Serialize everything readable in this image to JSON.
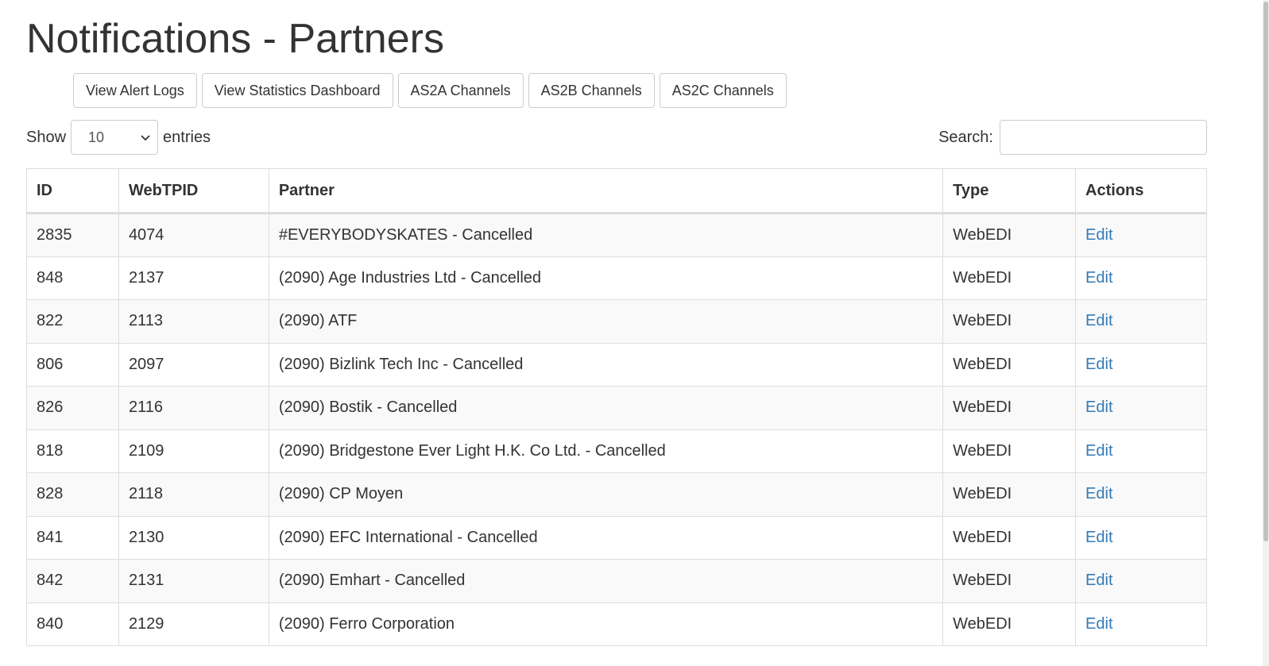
{
  "page": {
    "title": "Notifications - Partners"
  },
  "toolbar": {
    "buttons": [
      {
        "label": "View Alert Logs"
      },
      {
        "label": "View Statistics Dashboard"
      },
      {
        "label": "AS2A Channels"
      },
      {
        "label": "AS2B Channels"
      },
      {
        "label": "AS2C Channels"
      }
    ]
  },
  "length_control": {
    "show_label": "Show",
    "selected": "10",
    "entries_label": "entries"
  },
  "search": {
    "label": "Search:",
    "value": ""
  },
  "table": {
    "columns": [
      "ID",
      "WebTPID",
      "Partner",
      "Type",
      "Actions"
    ],
    "rows": [
      {
        "id": "2835",
        "webtpid": "4074",
        "partner": "#EVERYBODYSKATES - Cancelled",
        "type": "WebEDI",
        "action": "Edit"
      },
      {
        "id": "848",
        "webtpid": "2137",
        "partner": "(2090) Age Industries Ltd - Cancelled",
        "type": "WebEDI",
        "action": "Edit"
      },
      {
        "id": "822",
        "webtpid": "2113",
        "partner": "(2090) ATF",
        "type": "WebEDI",
        "action": "Edit"
      },
      {
        "id": "806",
        "webtpid": "2097",
        "partner": "(2090) Bizlink Tech Inc - Cancelled",
        "type": "WebEDI",
        "action": "Edit"
      },
      {
        "id": "826",
        "webtpid": "2116",
        "partner": "(2090) Bostik - Cancelled",
        "type": "WebEDI",
        "action": "Edit"
      },
      {
        "id": "818",
        "webtpid": "2109",
        "partner": "(2090) Bridgestone Ever Light H.K. Co Ltd. - Cancelled",
        "type": "WebEDI",
        "action": "Edit"
      },
      {
        "id": "828",
        "webtpid": "2118",
        "partner": "(2090) CP Moyen",
        "type": "WebEDI",
        "action": "Edit"
      },
      {
        "id": "841",
        "webtpid": "2130",
        "partner": "(2090) EFC International - Cancelled",
        "type": "WebEDI",
        "action": "Edit"
      },
      {
        "id": "842",
        "webtpid": "2131",
        "partner": "(2090) Emhart - Cancelled",
        "type": "WebEDI",
        "action": "Edit"
      },
      {
        "id": "840",
        "webtpid": "2129",
        "partner": "(2090) Ferro Corporation",
        "type": "WebEDI",
        "action": "Edit"
      }
    ]
  },
  "icons": {
    "select_arrow": "chevron-down-icon"
  },
  "colors": {
    "link": "#337ab7",
    "stripe": "#f9f9f9",
    "border": "#dddddd"
  }
}
